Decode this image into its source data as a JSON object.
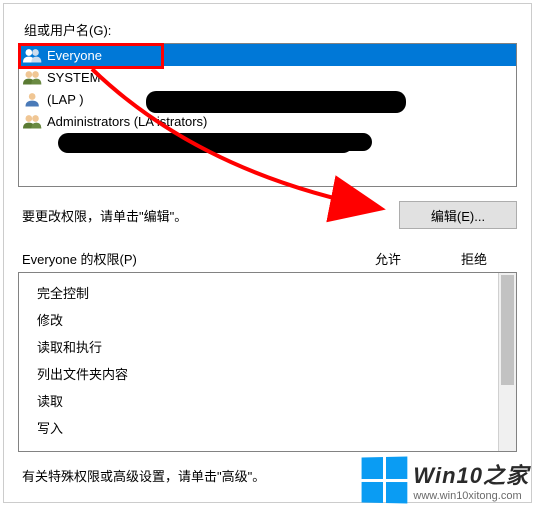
{
  "labels": {
    "group_label": "组或用户名(G):",
    "edit_hint": "要更改权限，请单击\"编辑\"。",
    "edit_button": "编辑(E)...",
    "perm_title": "Everyone 的权限(P)",
    "allow": "允许",
    "deny": "拒绝",
    "advanced_hint": "有关特殊权限或高级设置，请单击\"高级\"。"
  },
  "groups": [
    {
      "name": "Everyone",
      "selected": true
    },
    {
      "name": "SYSTEM",
      "selected": false
    },
    {
      "name": "             (LAP                                        )",
      "selected": false
    },
    {
      "name": "Administrators (LA                                  istrators)",
      "selected": false
    }
  ],
  "permissions": [
    "完全控制",
    "修改",
    "读取和执行",
    "列出文件夹内容",
    "读取",
    "写入"
  ],
  "watermark": {
    "title": "Win10之家",
    "url": "www.win10xitong.com"
  }
}
